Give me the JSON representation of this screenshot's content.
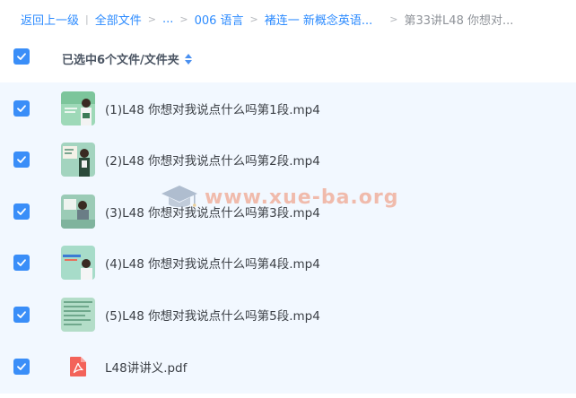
{
  "breadcrumb": {
    "back": "返回上一级",
    "all_files": "全部文件",
    "ellipsis": "...",
    "folder1": "006 语言",
    "folder2": "褚连一 新概念英语...",
    "current": "第33讲L48 你想对..."
  },
  "header": {
    "selection_text": "已选中6个文件/文件夹",
    "sort_icon": "sort-up-down-icon"
  },
  "files": [
    {
      "name": "(1)L48 你想对我说点什么吗第1段.mp4",
      "icon": "video-thumbnail"
    },
    {
      "name": "(2)L48 你想对我说点什么吗第2段.mp4",
      "icon": "video-thumbnail"
    },
    {
      "name": "(3)L48 你想对我说点什么吗第3段.mp4",
      "icon": "video-thumbnail"
    },
    {
      "name": "(4)L48 你想对我说点什么吗第4段.mp4",
      "icon": "video-thumbnail"
    },
    {
      "name": "(5)L48 你想对我说点什么吗第5段.mp4",
      "icon": "video-thumbnail"
    },
    {
      "name": "L48讲讲义.pdf",
      "icon": "pdf-icon"
    }
  ],
  "watermark": {
    "text": "www.xue-ba.org",
    "icon": "graduation-cap-icon"
  },
  "colors": {
    "accent": "#3a8ef8",
    "link": "#2c8bff",
    "row_selected": "#f2f8ff"
  }
}
